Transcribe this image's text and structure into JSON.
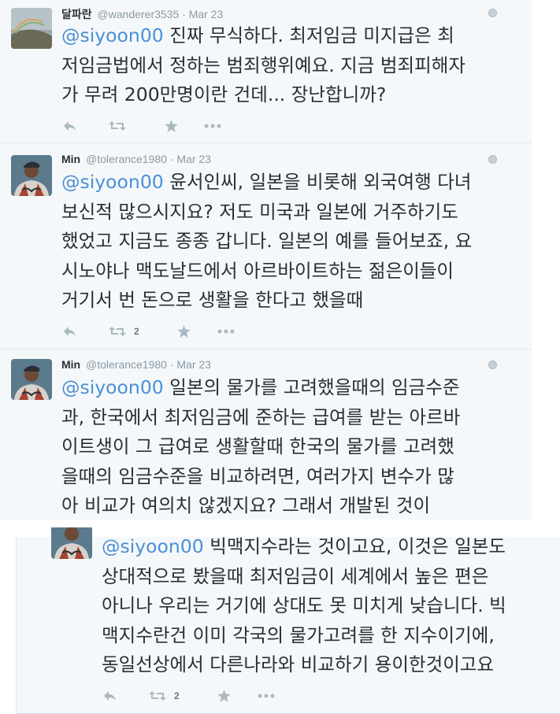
{
  "tweets": [
    {
      "name": "달파란",
      "handle": "@wanderer3535",
      "date": "· Mar 23",
      "mention": "@siyoon00",
      "line1": " 진짜 무식하다. 최저임금  미지급은 최",
      "lines": [
        "저임금법에서 정하는 범죄행위예요. 지금 범죄피해자",
        "가 무려 200만명이란 건데... 장난합니까?"
      ],
      "retweet_count": ""
    },
    {
      "name": "Min",
      "handle": "@tolerance1980",
      "date": "· Mar 23",
      "mention": "@siyoon00",
      "line1": " 윤서인씨, 일본을 비롯해 외국여행 다녀",
      "lines": [
        "보신적 많으시지요? 저도 미국과 일본에 거주하기도",
        "했었고 지금도 종종 갑니다. 일본의 예를 들어보죠, 요",
        "시노야나 맥도날드에서 아르바이트하는 젊은이들이",
        "거기서 번 돈으로 생활을 한다고 했을때"
      ],
      "retweet_count": "2"
    },
    {
      "name": "Min",
      "handle": "@tolerance1980",
      "date": "· Mar 23",
      "mention": "@siyoon00",
      "line1": " 일본의 물가를 고려했을때의 임금수준",
      "lines": [
        "과, 한국에서 최저임금에 준하는 급여를 받는 아르바",
        "이트생이 그 급여로 생활할때 한국의 물가를 고려했",
        "을때의 임금수준을 비교하려면, 여러가지 변수가 많",
        "아 비교가 여의치 않겠지요? 그래서 개발된 것이"
      ]
    },
    {
      "mention": "@siyoon00",
      "line1": " 빅맥지수라는 것이고요, 이것은 일본도",
      "lines": [
        "상대적으로 봤을때 최저임금이 세계에서 높은 편은",
        "아니나 우리는 거기에 상대도 못 미치게 낮습니다. 빅",
        "맥지수란건 이미 각국의 물가고려를 한 지수이기에,",
        "동일선상에서 다른나라와 비교하기 용이한것이고요"
      ],
      "retweet_count": "2"
    }
  ],
  "icons": {
    "reply": "reply-icon",
    "retweet": "retweet-icon",
    "favorite": "star-icon",
    "more": "more-icon",
    "globe": "globe-icon"
  },
  "colors": {
    "mention": "#4a8fd6",
    "card_bg": "#f5f8fa",
    "action_icon": "#aab8c2"
  }
}
